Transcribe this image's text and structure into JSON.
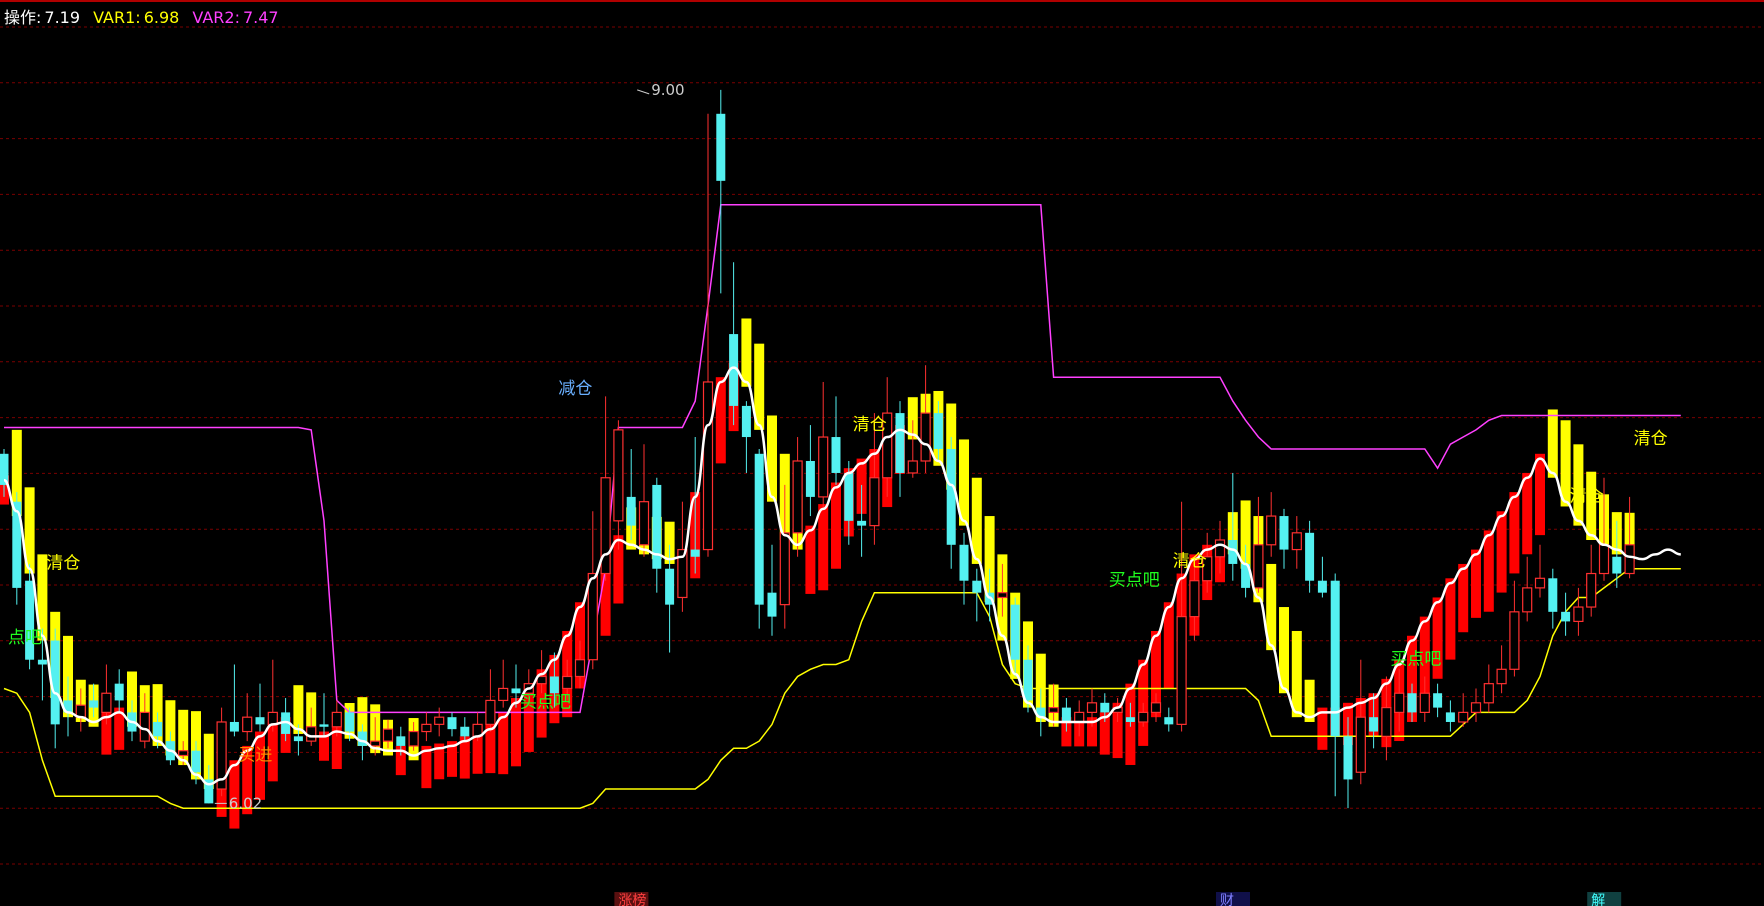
{
  "header": {
    "items": [
      {
        "label": "操作:",
        "value": "7.19",
        "color": "#ffffff"
      },
      {
        "label": "VAR1:",
        "value": "6.98",
        "color": "#ffff00"
      },
      {
        "label": "VAR2:",
        "value": "7.47",
        "color": "#ff40ff"
      }
    ]
  },
  "chart_data": {
    "type": "candlestick",
    "title": "",
    "ylim": [
      5.7,
      9.25
    ],
    "grid": true,
    "colors": {
      "up": "#ff3030",
      "down": "#54f0f0",
      "var2": "#ff40ff",
      "var1": "#ffff00",
      "white_line": "#ffffff",
      "band_bull": "#ff0000",
      "band_bear": "#ffff00",
      "grid": "#7a0000"
    },
    "price_labels": [
      {
        "text": "9.00",
        "index": 49,
        "value": 9.0
      },
      {
        "text": "6.02",
        "index": 16,
        "value": 6.02
      }
    ],
    "annotations": [
      {
        "text": "清仓",
        "index": 3,
        "value": 7.0,
        "color": "#ffff00"
      },
      {
        "text": "点吧",
        "index": 0,
        "value": 6.69,
        "color": "#20ff20"
      },
      {
        "text": "买进",
        "index": 18,
        "value": 6.2,
        "color": "#ff8c00"
      },
      {
        "text": "减仓",
        "index": 43,
        "value": 7.73,
        "color": "#6ab0ff"
      },
      {
        "text": "买点吧",
        "index": 40,
        "value": 6.42,
        "color": "#20ff20"
      },
      {
        "text": "清仓",
        "index": 66,
        "value": 7.58,
        "color": "#ffff00"
      },
      {
        "text": "买点吧",
        "index": 86,
        "value": 6.93,
        "color": "#20ff20"
      },
      {
        "text": "清仓",
        "index": 91,
        "value": 7.01,
        "color": "#ffff00"
      },
      {
        "text": "买点吧",
        "index": 108,
        "value": 6.6,
        "color": "#20ff20"
      },
      {
        "text": "清仓",
        "index": 122,
        "value": 7.28,
        "color": "#ffff00"
      },
      {
        "text": "清仓",
        "index": 127,
        "value": 7.52,
        "color": "#ffff00"
      }
    ],
    "bottom_markers": [
      {
        "text": "涨榜",
        "index": 48,
        "color": "#ff4040",
        "bg": "#5a1010"
      },
      {
        "text": "财",
        "index": 95,
        "color": "#8080ff",
        "bg": "#10104a"
      },
      {
        "text": "解",
        "index": 124,
        "color": "#40ffff",
        "bg": "#104040"
      }
    ],
    "candles": [
      [
        7.48,
        7.35,
        7.5,
        7.3
      ],
      [
        7.28,
        6.92,
        7.32,
        6.85
      ],
      [
        6.95,
        6.62,
        7.02,
        6.58
      ],
      [
        6.62,
        6.6,
        6.75,
        6.45
      ],
      [
        6.7,
        6.35,
        6.75,
        6.25
      ],
      [
        6.45,
        6.4,
        6.55,
        6.3
      ],
      [
        6.38,
        6.43,
        6.5,
        6.32
      ],
      [
        6.45,
        6.42,
        6.52,
        6.38
      ],
      [
        6.4,
        6.48,
        6.6,
        6.35
      ],
      [
        6.52,
        6.45,
        6.58,
        6.4
      ],
      [
        6.4,
        6.32,
        6.45,
        6.28
      ],
      [
        6.28,
        6.4,
        6.48,
        6.25
      ],
      [
        6.36,
        6.3,
        6.4,
        6.25
      ],
      [
        6.28,
        6.2,
        6.32,
        6.18
      ],
      [
        6.22,
        6.24,
        6.28,
        6.18
      ],
      [
        6.24,
        6.15,
        6.28,
        6.1
      ],
      [
        6.12,
        6.02,
        6.18,
        6.02
      ],
      [
        6.08,
        6.36,
        6.42,
        6.05
      ],
      [
        6.36,
        6.32,
        6.6,
        6.3
      ],
      [
        6.32,
        6.38,
        6.48,
        6.28
      ],
      [
        6.38,
        6.35,
        6.52,
        6.32
      ],
      [
        6.35,
        6.4,
        6.62,
        6.32
      ],
      [
        6.4,
        6.31,
        6.46,
        6.28
      ],
      [
        6.3,
        6.28,
        6.35,
        6.22
      ],
      [
        6.28,
        6.34,
        6.42,
        6.26
      ],
      [
        6.35,
        6.34,
        6.48,
        6.3
      ],
      [
        6.34,
        6.4,
        6.45,
        6.3
      ],
      [
        6.4,
        6.32,
        6.42,
        6.28
      ],
      [
        6.32,
        6.26,
        6.35,
        6.2
      ],
      [
        6.26,
        6.28,
        6.38,
        6.22
      ],
      [
        6.28,
        6.33,
        6.37,
        6.25
      ],
      [
        6.3,
        6.26,
        6.34,
        6.22
      ],
      [
        6.26,
        6.32,
        6.36,
        6.24
      ],
      [
        6.32,
        6.35,
        6.4,
        6.28
      ],
      [
        6.35,
        6.38,
        6.42,
        6.3
      ],
      [
        6.38,
        6.33,
        6.4,
        6.3
      ],
      [
        6.34,
        6.3,
        6.38,
        6.28
      ],
      [
        6.3,
        6.35,
        6.4,
        6.28
      ],
      [
        6.35,
        6.45,
        6.58,
        6.32
      ],
      [
        6.45,
        6.5,
        6.62,
        6.42
      ],
      [
        6.5,
        6.48,
        6.6,
        6.42
      ],
      [
        6.48,
        6.52,
        6.58,
        6.45
      ],
      [
        6.52,
        6.55,
        6.66,
        6.48
      ],
      [
        6.55,
        6.48,
        6.65,
        6.42
      ],
      [
        6.5,
        6.55,
        6.62,
        6.45
      ],
      [
        6.55,
        6.62,
        6.7,
        6.5
      ],
      [
        6.62,
        6.98,
        7.24,
        6.58
      ],
      [
        6.98,
        7.38,
        7.72,
        6.95
      ],
      [
        7.2,
        7.58,
        7.62,
        7.08
      ],
      [
        7.3,
        7.18,
        7.5,
        7.12
      ],
      [
        7.1,
        7.28,
        7.52,
        7.05
      ],
      [
        7.35,
        7.0,
        7.38,
        6.9
      ],
      [
        7.0,
        6.85,
        7.1,
        6.65
      ],
      [
        6.88,
        7.08,
        7.28,
        6.82
      ],
      [
        7.08,
        7.05,
        7.55,
        6.98
      ],
      [
        7.08,
        7.78,
        8.9,
        7.05
      ],
      [
        8.9,
        8.62,
        9.0,
        8.15
      ],
      [
        7.98,
        7.68,
        8.28,
        7.6
      ],
      [
        7.68,
        7.55,
        7.7,
        7.4
      ],
      [
        7.48,
        6.85,
        7.5,
        6.75
      ],
      [
        6.9,
        6.8,
        7.1,
        6.72
      ],
      [
        6.85,
        7.15,
        7.35,
        6.75
      ],
      [
        7.15,
        7.45,
        7.55,
        7.05
      ],
      [
        7.45,
        7.3,
        7.6,
        7.22
      ],
      [
        7.3,
        7.55,
        7.78,
        7.25
      ],
      [
        7.55,
        7.4,
        7.72,
        7.35
      ],
      [
        7.4,
        7.2,
        7.45,
        7.1
      ],
      [
        7.2,
        7.18,
        7.35,
        7.05
      ],
      [
        7.18,
        7.38,
        7.65,
        7.1
      ],
      [
        7.38,
        7.65,
        7.8,
        7.3
      ],
      [
        7.65,
        7.4,
        7.7,
        7.3
      ],
      [
        7.4,
        7.45,
        7.62,
        7.38
      ],
      [
        7.45,
        7.65,
        7.85,
        7.4
      ],
      [
        7.65,
        7.5,
        7.7,
        7.45
      ],
      [
        7.5,
        7.1,
        7.55,
        7.0
      ],
      [
        7.1,
        6.95,
        7.15,
        6.85
      ],
      [
        6.95,
        6.9,
        7.0,
        6.78
      ],
      [
        6.9,
        6.85,
        7.0,
        6.78
      ],
      [
        6.88,
        6.9,
        7.02,
        6.8
      ],
      [
        6.85,
        6.62,
        6.88,
        6.55
      ],
      [
        6.62,
        6.45,
        6.68,
        6.4
      ],
      [
        6.42,
        6.38,
        6.5,
        6.3
      ],
      [
        6.4,
        6.42,
        6.52,
        6.34
      ],
      [
        6.42,
        6.36,
        6.46,
        6.32
      ],
      [
        6.36,
        6.4,
        6.45,
        6.3
      ],
      [
        6.4,
        6.44,
        6.5,
        6.34
      ],
      [
        6.44,
        6.4,
        6.48,
        6.36
      ],
      [
        6.4,
        6.42,
        6.46,
        6.36
      ],
      [
        6.38,
        6.36,
        6.44,
        6.34
      ],
      [
        6.36,
        6.4,
        6.44,
        6.34
      ],
      [
        6.4,
        6.44,
        6.48,
        6.36
      ],
      [
        6.38,
        6.35,
        6.42,
        6.32
      ],
      [
        6.35,
        6.8,
        7.28,
        6.32
      ],
      [
        6.8,
        6.95,
        7.05,
        6.7
      ],
      [
        6.95,
        7.05,
        7.15,
        6.9
      ],
      [
        7.05,
        7.12,
        7.2,
        6.98
      ],
      [
        7.12,
        7.02,
        7.4,
        6.95
      ],
      [
        7.02,
        6.92,
        7.1,
        6.88
      ],
      [
        6.92,
        7.1,
        7.3,
        6.9
      ],
      [
        7.1,
        7.22,
        7.32,
        7.05
      ],
      [
        7.22,
        7.08,
        7.25,
        7.0
      ],
      [
        7.08,
        7.15,
        7.22,
        7.0
      ],
      [
        7.15,
        6.95,
        7.2,
        6.9
      ],
      [
        6.95,
        6.9,
        7.05,
        6.88
      ],
      [
        6.95,
        6.3,
        6.98,
        6.05
      ],
      [
        6.3,
        6.12,
        6.38,
        6.0
      ],
      [
        6.15,
        6.38,
        6.62,
        6.1
      ],
      [
        6.38,
        6.32,
        6.48,
        6.25
      ],
      [
        6.3,
        6.42,
        6.55,
        6.2
      ],
      [
        6.4,
        6.48,
        6.58,
        6.32
      ],
      [
        6.48,
        6.4,
        6.52,
        6.36
      ],
      [
        6.4,
        6.48,
        6.55,
        6.36
      ],
      [
        6.48,
        6.42,
        6.52,
        6.38
      ],
      [
        6.4,
        6.36,
        6.45,
        6.32
      ],
      [
        6.36,
        6.4,
        6.48,
        6.34
      ],
      [
        6.4,
        6.44,
        6.5,
        6.36
      ],
      [
        6.44,
        6.52,
        6.6,
        6.4
      ],
      [
        6.52,
        6.58,
        6.68,
        6.48
      ],
      [
        6.58,
        6.82,
        6.95,
        6.55
      ],
      [
        6.82,
        6.92,
        7.05,
        6.78
      ],
      [
        6.92,
        6.96,
        7.1,
        6.88
      ],
      [
        6.96,
        6.82,
        7.0,
        6.75
      ],
      [
        6.82,
        6.78,
        6.9,
        6.72
      ],
      [
        6.78,
        6.84,
        6.92,
        6.72
      ],
      [
        6.84,
        6.98,
        7.1,
        6.8
      ],
      [
        6.98,
        7.1,
        7.38,
        6.95
      ],
      [
        7.05,
        6.98,
        7.2,
        6.92
      ],
      [
        6.98,
        7.1,
        7.3,
        6.96
      ]
    ],
    "white_line": [
      7.37,
      7.24,
      7.0,
      6.72,
      6.48,
      6.4,
      6.38,
      6.36,
      6.38,
      6.4,
      6.36,
      6.33,
      6.28,
      6.24,
      6.2,
      6.14,
      6.1,
      6.12,
      6.18,
      6.24,
      6.3,
      6.35,
      6.36,
      6.33,
      6.3,
      6.3,
      6.32,
      6.31,
      6.28,
      6.25,
      6.24,
      6.24,
      6.22,
      6.24,
      6.25,
      6.26,
      6.28,
      6.3,
      6.33,
      6.38,
      6.44,
      6.5,
      6.56,
      6.62,
      6.72,
      6.84,
      6.96,
      7.06,
      7.12,
      7.1,
      7.08,
      7.06,
      7.04,
      7.05,
      7.3,
      7.6,
      7.78,
      7.84,
      7.78,
      7.6,
      7.3,
      7.14,
      7.1,
      7.16,
      7.25,
      7.34,
      7.4,
      7.44,
      7.48,
      7.55,
      7.58,
      7.56,
      7.52,
      7.45,
      7.35,
      7.2,
      7.04,
      6.88,
      6.72,
      6.56,
      6.44,
      6.38,
      6.36,
      6.36,
      6.36,
      6.36,
      6.38,
      6.42,
      6.5,
      6.6,
      6.72,
      6.84,
      6.96,
      7.04,
      7.08,
      7.1,
      7.08,
      7.02,
      6.88,
      6.68,
      6.5,
      6.4,
      6.38,
      6.4,
      6.4,
      6.42,
      6.44,
      6.46,
      6.52,
      6.6,
      6.7,
      6.78,
      6.86,
      6.94,
      7.0,
      7.06,
      7.14,
      7.22,
      7.3,
      7.38,
      7.46,
      7.4,
      7.28,
      7.2,
      7.14,
      7.1,
      7.08,
      7.05,
      7.04,
      7.06,
      7.08,
      7.06
    ],
    "var2_line": [
      7.59,
      7.59,
      7.59,
      7.59,
      7.59,
      7.59,
      7.59,
      7.59,
      7.59,
      7.59,
      7.59,
      7.59,
      7.59,
      7.59,
      7.59,
      7.59,
      7.59,
      7.59,
      7.59,
      7.59,
      7.59,
      7.59,
      7.59,
      7.59,
      7.58,
      7.2,
      6.45,
      6.4,
      6.4,
      6.4,
      6.4,
      6.4,
      6.4,
      6.4,
      6.4,
      6.4,
      6.4,
      6.4,
      6.4,
      6.4,
      6.4,
      6.4,
      6.4,
      6.4,
      6.4,
      6.4,
      6.7,
      7.0,
      7.59,
      7.59,
      7.59,
      7.59,
      7.59,
      7.59,
      7.7,
      8.1,
      8.52,
      8.52,
      8.52,
      8.52,
      8.52,
      8.52,
      8.52,
      8.52,
      8.52,
      8.52,
      8.52,
      8.52,
      8.52,
      8.52,
      8.52,
      8.52,
      8.52,
      8.52,
      8.52,
      8.52,
      8.52,
      8.52,
      8.52,
      8.52,
      8.52,
      8.52,
      7.8,
      7.8,
      7.8,
      7.8,
      7.8,
      7.8,
      7.8,
      7.8,
      7.8,
      7.8,
      7.8,
      7.8,
      7.8,
      7.8,
      7.7,
      7.62,
      7.55,
      7.5,
      7.5,
      7.5,
      7.5,
      7.5,
      7.5,
      7.5,
      7.5,
      7.5,
      7.5,
      7.5,
      7.5,
      7.5,
      7.42,
      7.52,
      7.55,
      7.58,
      7.62,
      7.64,
      7.64,
      7.64,
      7.64,
      7.64,
      7.64,
      7.64,
      7.64,
      7.64,
      7.64,
      7.64,
      7.64,
      7.64,
      7.64,
      7.64
    ],
    "var1_line": [
      6.5,
      6.48,
      6.4,
      6.2,
      6.05,
      6.05,
      6.05,
      6.05,
      6.05,
      6.05,
      6.05,
      6.05,
      6.05,
      6.02,
      6.0,
      6.0,
      6.0,
      6.0,
      6.0,
      6.0,
      6.0,
      6.0,
      6.0,
      6.0,
      6.0,
      6.0,
      6.0,
      6.0,
      6.0,
      6.0,
      6.0,
      6.0,
      6.0,
      6.0,
      6.0,
      6.0,
      6.0,
      6.0,
      6.0,
      6.0,
      6.0,
      6.0,
      6.0,
      6.0,
      6.0,
      6.0,
      6.02,
      6.08,
      6.08,
      6.08,
      6.08,
      6.08,
      6.08,
      6.08,
      6.08,
      6.12,
      6.2,
      6.25,
      6.25,
      6.28,
      6.35,
      6.48,
      6.55,
      6.58,
      6.6,
      6.6,
      6.62,
      6.78,
      6.9,
      6.9,
      6.9,
      6.9,
      6.9,
      6.9,
      6.9,
      6.9,
      6.9,
      6.8,
      6.6,
      6.52,
      6.5,
      6.5,
      6.5,
      6.5,
      6.5,
      6.5,
      6.5,
      6.5,
      6.5,
      6.5,
      6.5,
      6.5,
      6.5,
      6.5,
      6.5,
      6.5,
      6.5,
      6.5,
      6.45,
      6.3,
      6.3,
      6.3,
      6.3,
      6.3,
      6.3,
      6.3,
      6.3,
      6.3,
      6.3,
      6.3,
      6.3,
      6.3,
      6.3,
      6.3,
      6.35,
      6.4,
      6.4,
      6.4,
      6.4,
      6.45,
      6.55,
      6.72,
      6.82,
      6.88,
      6.88,
      6.92,
      6.96,
      7.0,
      7.0,
      7.0,
      7.0,
      7.0
    ]
  }
}
